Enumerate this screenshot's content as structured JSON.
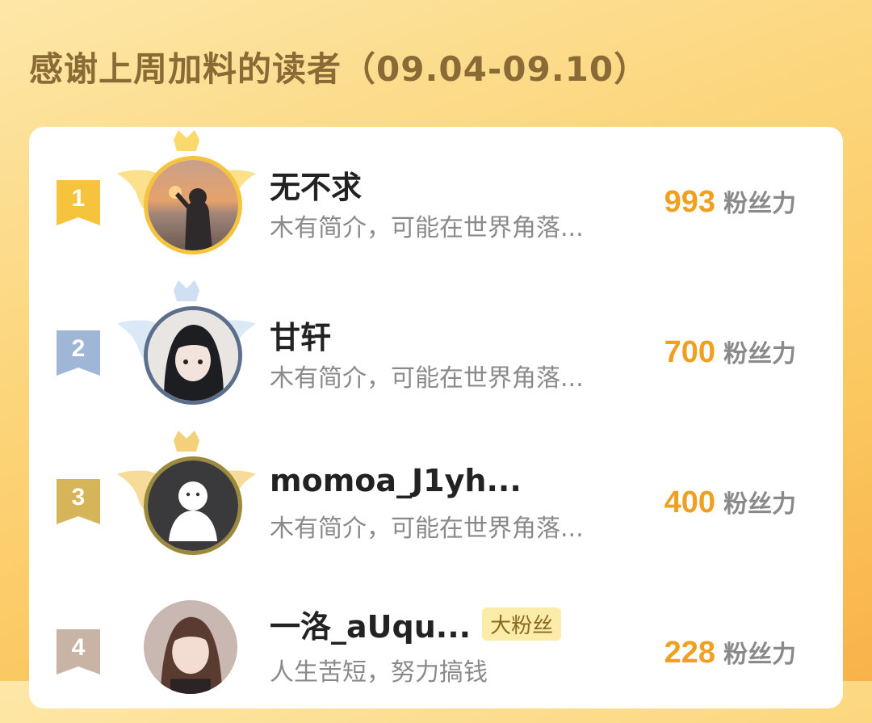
{
  "header": {
    "title": "感谢上周加料的读者（09.04-09.10）"
  },
  "readers": [
    {
      "rank": "1",
      "name": "无不求",
      "bio": "木有简介，可能在世界角落...",
      "score": "993",
      "unit": "粉丝力",
      "tag": ""
    },
    {
      "rank": "2",
      "name": "甘轩",
      "bio": "木有简介，可能在世界角落...",
      "score": "700",
      "unit": "粉丝力",
      "tag": ""
    },
    {
      "rank": "3",
      "name": "momoa_J1yh...",
      "bio": "木有简介，可能在世界角落...",
      "score": "400",
      "unit": "粉丝力",
      "tag": ""
    },
    {
      "rank": "4",
      "name": "一洛_aUqu...",
      "bio": "人生苦短，努力搞钱",
      "score": "228",
      "unit": "粉丝力",
      "tag": "大粉丝"
    }
  ],
  "colors": {
    "rank1": "#f6c33d",
    "rank2": "#9fb6d6",
    "rank3": "#d6b45a",
    "rank4": "#c9b3a4",
    "score": "#f0a020"
  }
}
